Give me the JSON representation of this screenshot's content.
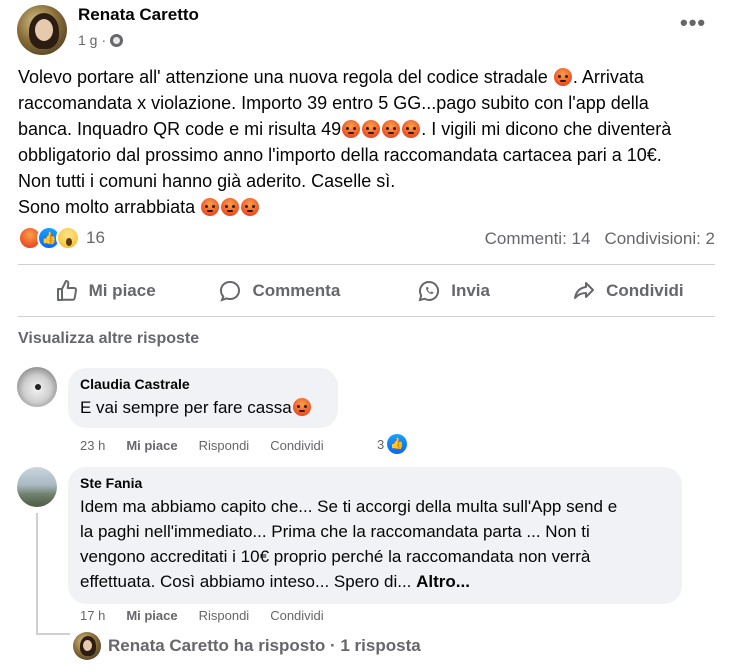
{
  "post": {
    "author": "Renata Caretto",
    "time": "1 g",
    "visibility_icon": "globe-icon",
    "menu_icon": "more-options-icon",
    "body_lines": [
      "Volevo portare all' attenzione una nuova regola del codice stradale",
      ". Arrivata",
      "raccomandata x violazione. Importo 39 entro 5 GG...pago subito con l'app della",
      "banca. Inquadro QR code e mi risulta 49",
      ". I vigili mi dicono che diventerà",
      "obbligatorio dal prossimo anno l'importo della raccomandata cartacea pari a 10€.",
      "Non tutti i comuni hanno già aderito. Caselle sì.",
      "Sono molto arrabbiata"
    ],
    "reactions": {
      "icons": [
        "angry-reaction-icon",
        "like-reaction-icon",
        "wow-reaction-icon"
      ],
      "count": "16"
    },
    "comments_label": "Commenti: 14",
    "shares_label": "Condivisioni: 2"
  },
  "actions": {
    "like": "Mi piace",
    "comment": "Commenta",
    "send": "Invia",
    "share": "Condividi"
  },
  "view_more": "Visualizza altre risposte",
  "comments": [
    {
      "name": "Claudia Castrale",
      "text": "E vai sempre per fare cassa",
      "time": "23 h",
      "like": "Mi piace",
      "reply": "Rispondi",
      "share": "Condividi",
      "likes_count": "3"
    },
    {
      "name": "Ste Fania",
      "text_lines": [
        "Idem ma abbiamo capito che... Se ti accorgi della multa sull'App send e",
        "la paghi nell'immediato... Prima che la raccomandata parta ... Non ti",
        "vengono accreditati i 10€ proprio perché la raccomandata non verrà",
        "effettuata. Così abbiamo inteso... Spero di..."
      ],
      "more": "Altro...",
      "time": "17 h",
      "like": "Mi piace",
      "reply": "Rispondi",
      "share": "Condividi"
    }
  ],
  "reply_summary": "Renata Caretto ha risposto · 1 risposta",
  "colors": {
    "text": "#050505",
    "secondary": "#65676b",
    "bubble": "#f0f2f5",
    "like_blue": "#0866ff",
    "divider": "#ced0d4"
  }
}
